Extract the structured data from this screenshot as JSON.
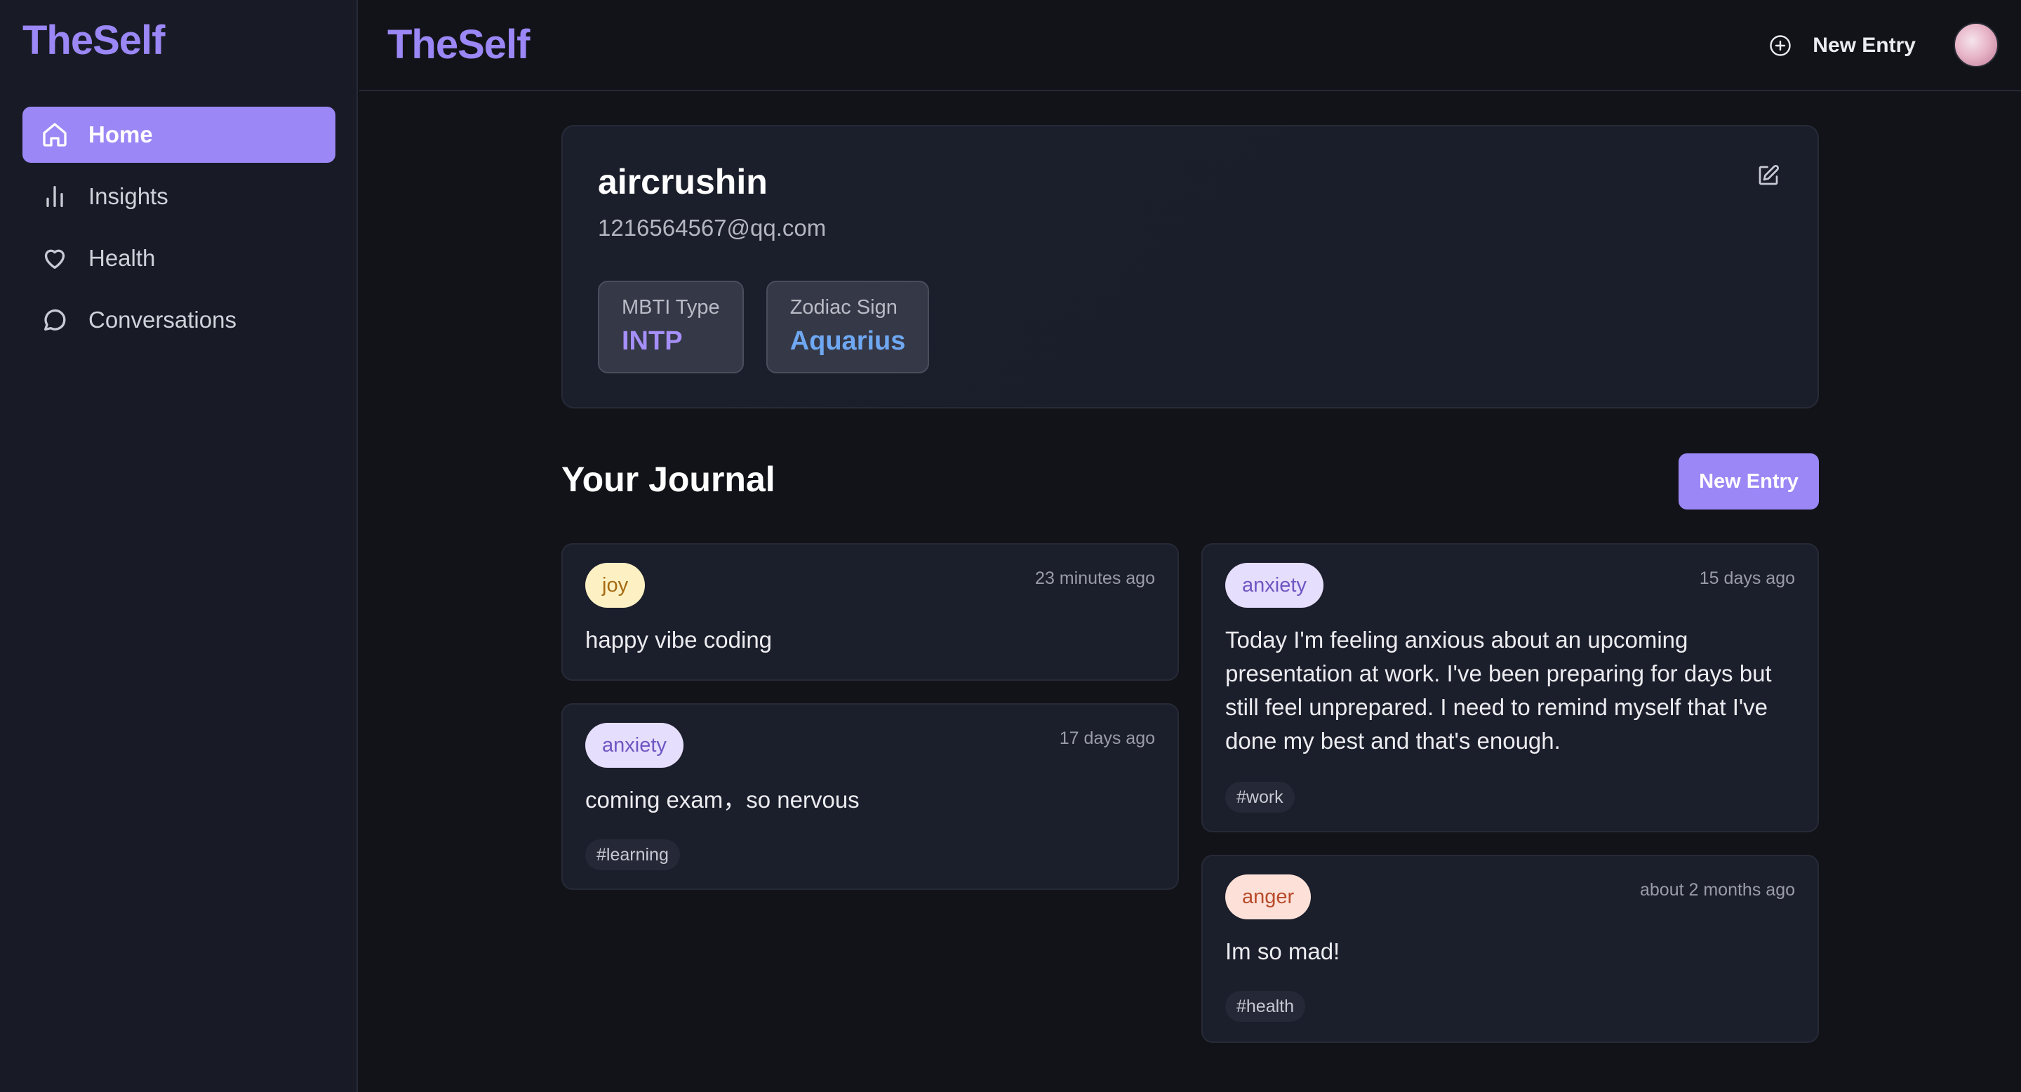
{
  "app": {
    "logo": "TheSelf",
    "brand": "TheSelf"
  },
  "sidebar": {
    "items": [
      {
        "label": "Home",
        "icon": "home-icon",
        "active": true
      },
      {
        "label": "Insights",
        "icon": "bar-chart-icon",
        "active": false
      },
      {
        "label": "Health",
        "icon": "heart-icon",
        "active": false
      },
      {
        "label": "Conversations",
        "icon": "message-circle-icon",
        "active": false
      }
    ]
  },
  "header": {
    "new_entry_label": "New Entry",
    "new_entry_icon": "plus-circle-icon",
    "avatar_icon": "avatar"
  },
  "profile": {
    "username": "aircrushin",
    "email": "1216564567@qq.com",
    "edit_icon": "edit-icon",
    "mbti_label": "MBTI Type",
    "mbti_value": "INTP",
    "zodiac_label": "Zodiac Sign",
    "zodiac_value": "Aquarius"
  },
  "journal": {
    "title": "Your Journal",
    "new_entry_label": "New Entry",
    "entries": [
      {
        "mood": "joy",
        "time": "23 minutes ago",
        "text": "happy vibe coding",
        "tag": ""
      },
      {
        "mood": "anxiety",
        "time": "17 days ago",
        "text": "coming exam，so nervous",
        "tag": "#learning"
      },
      {
        "mood": "anxiety",
        "time": "15 days ago",
        "text": "Today I'm feeling anxious about an upcoming presentation at work. I've been preparing for days but still feel unprepared. I need to remind myself that I've done my best and that's enough.",
        "tag": "#work"
      },
      {
        "mood": "anger",
        "time": "about 2 months ago",
        "text": "Im so mad!",
        "tag": "#health"
      }
    ]
  },
  "colors": {
    "accent": "#9b87f5",
    "background": "#121318",
    "sidebar": "#181b26",
    "card": "#1b1e2b",
    "mbti_value": "#a58ff8",
    "zodiac_value": "#6fa8f2",
    "joy_badge": "#fdf1c4",
    "anxiety_badge": "#e6defd",
    "anger_badge": "#fde1d8"
  }
}
